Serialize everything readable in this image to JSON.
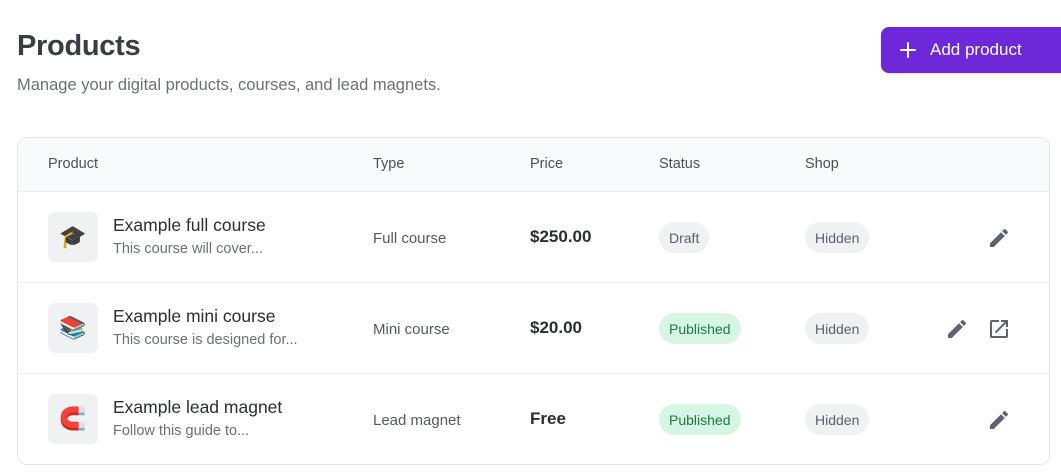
{
  "header": {
    "title": "Products",
    "subtitle": "Manage your digital products, courses, and lead magnets.",
    "add_button_label": "Add product"
  },
  "table": {
    "columns": [
      "Product",
      "Type",
      "Price",
      "Status",
      "Shop"
    ],
    "rows": [
      {
        "icon": "graduation-cap-icon",
        "emoji": "🎓",
        "name": "Example full course",
        "description": "This course will cover...",
        "type": "Full course",
        "price": "$250.00",
        "status": "Draft",
        "shop": "Hidden",
        "actions": [
          "edit"
        ]
      },
      {
        "icon": "books-icon",
        "emoji": "📚",
        "name": "Example mini course",
        "description": "This course is designed for...",
        "type": "Mini course",
        "price": "$20.00",
        "status": "Published",
        "shop": "Hidden",
        "actions": [
          "edit",
          "open-external"
        ]
      },
      {
        "icon": "magnet-icon",
        "emoji": "🧲",
        "name": "Example lead magnet",
        "description": "Follow this guide to...",
        "type": "Lead magnet",
        "price": "Free",
        "status": "Published",
        "shop": "Hidden",
        "actions": [
          "edit"
        ]
      }
    ]
  },
  "colors": {
    "accent": "#6d28d9",
    "published_bg": "#d6f5e3",
    "published_text": "#1b7a45",
    "neutral_badge_bg": "#f0f1f3"
  }
}
